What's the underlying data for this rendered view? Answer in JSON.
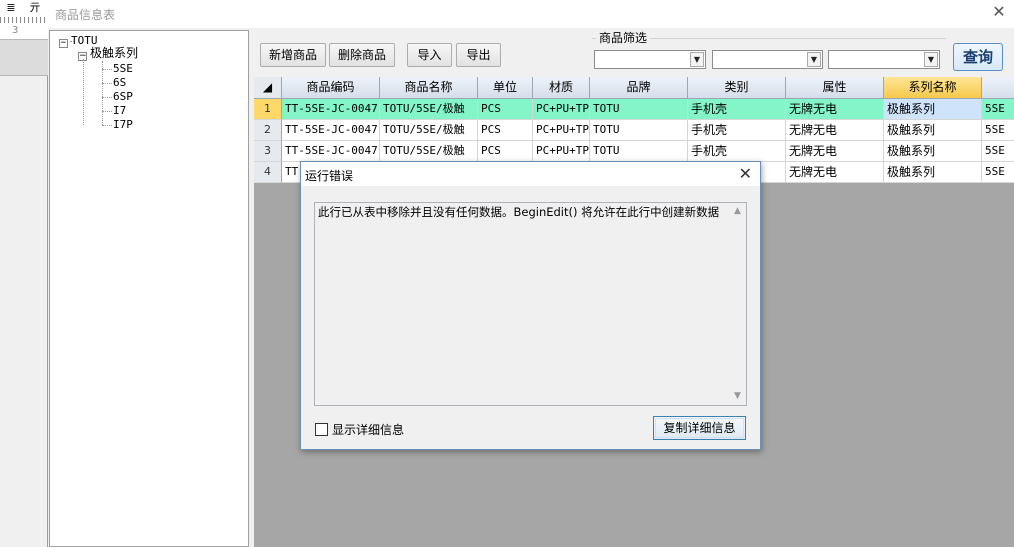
{
  "bg_ruler": {
    "icon1": "≣",
    "icon2": "亓",
    "num": "3"
  },
  "window": {
    "title": "商品信息表"
  },
  "tree": {
    "root": "TOTU",
    "child": "极触系列",
    "leaves": [
      "5SE",
      "6S",
      "6SP",
      "I7",
      "I7P"
    ]
  },
  "toolbar": {
    "add_label": "新增商品",
    "delete_label": "删除商品",
    "import_label": "导入",
    "export_label": "导出",
    "filter_label": "商品筛选",
    "query_label": "查询"
  },
  "grid": {
    "columns": [
      "商品编码",
      "商品名称",
      "单位",
      "材质",
      "品牌",
      "类别",
      "属性",
      "系列名称"
    ],
    "rows": [
      {
        "n": "1",
        "code": "TT-5SE-JC-0047",
        "name": "TOTU/5SE/极触",
        "unit": "PCS",
        "mat": "PC+PU+TP",
        "brand": "TOTU",
        "cat": "手机壳",
        "attr": "无牌无电",
        "series": "极触系列",
        "extra": "5SE"
      },
      {
        "n": "2",
        "code": "TT-5SE-JC-0047",
        "name": "TOTU/5SE/极触",
        "unit": "PCS",
        "mat": "PC+PU+TP",
        "brand": "TOTU",
        "cat": "手机壳",
        "attr": "无牌无电",
        "series": "极触系列",
        "extra": "5SE"
      },
      {
        "n": "3",
        "code": "TT-5SE-JC-0047",
        "name": "TOTU/5SE/极触",
        "unit": "PCS",
        "mat": "PC+PU+TP",
        "brand": "TOTU",
        "cat": "手机壳",
        "attr": "无牌无电",
        "series": "极触系列",
        "extra": "5SE"
      },
      {
        "n": "4",
        "code": "TT",
        "name": "",
        "unit": "",
        "mat": "",
        "brand": "",
        "cat": "",
        "attr": "无牌无电",
        "series": "极触系列",
        "extra": "5SE"
      }
    ]
  },
  "dialog": {
    "title": "运行错误",
    "message": "此行已从表中移除并且没有任何数据。BeginEdit() 将允许在此行中创建新数据",
    "checkbox_label": "显示详细信息",
    "copy_label": "复制详细信息"
  },
  "icons": {
    "close": "close-icon",
    "expand": "minus-box-icon",
    "dropdown": "chevron-down-icon"
  }
}
